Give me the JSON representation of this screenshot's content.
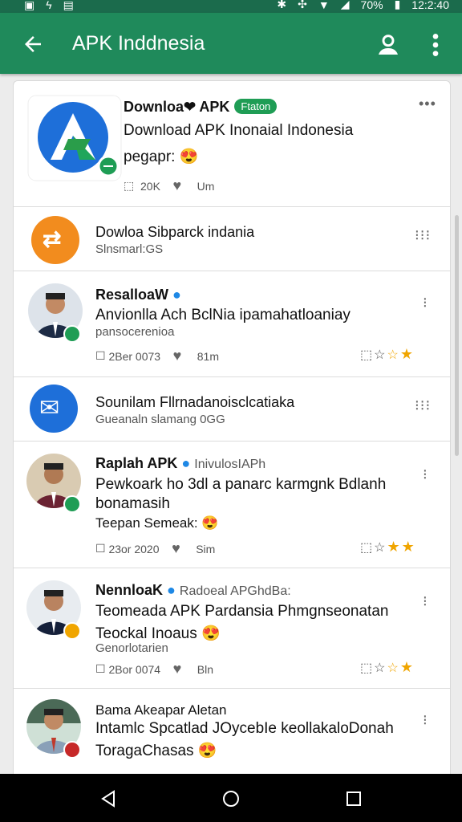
{
  "status": {
    "battery_pct": "70%",
    "time": "12:2:40"
  },
  "appbar": {
    "title": "APK Inddnesia"
  },
  "feed": [
    {
      "name": "Downloa❤ APK",
      "badge": "Ftaton",
      "text": "Download APK Inonaial Indonesia",
      "text2": "pegapr:",
      "likes": "20K",
      "meta3": "Um"
    },
    {
      "name": "Dowloa Sibparck indania",
      "sub": "Slnsmarl:GS"
    },
    {
      "name": "ResalloaW",
      "text": "Anvionlla Ach BclNia ipamahatloaniay",
      "sub": "pansocerenioa",
      "date": "2Ber 0073",
      "meta3": "81m"
    },
    {
      "name": "Sounilam Fllrnadanoisclcatiaka",
      "sub": "Gueanaln slamang 0GG"
    },
    {
      "name": "Raplah APK",
      "handle": "InivulosIAPh",
      "text": "Pewkoark ho 3dl a panarc karmgnk Bdlanh",
      "text2": "bonamasih",
      "text3": "Teepan Semeak:",
      "date": "23or 2020",
      "meta3": "Sim"
    },
    {
      "name": "NennloaK",
      "handle": "Radoeal APGhdBa:",
      "text": "Teomeada APK Pardansia Phmgnseonatan",
      "text2": "Teockal Inoaus",
      "sub": "Genorlotarien",
      "date": "2Bor 0074",
      "meta3": "Bln"
    },
    {
      "name": "Bama Akeapar Aletan",
      "text": "Intamlc Spcatlad JOycebIe keollakaloDonah",
      "text2": "ToragaChasas"
    }
  ],
  "colors": {
    "appbar": "#1f8a5b",
    "statusbar": "#1b6b4c",
    "accent": "#1f9d55",
    "star": "#f0a500",
    "verified": "#1e88e5"
  },
  "icons": [
    "back-arrow-icon",
    "account-icon",
    "more-vert-icon",
    "like-icon",
    "heart-icon",
    "star-icon",
    "verified-icon",
    "mail-icon",
    "nav-back-icon",
    "nav-home-icon",
    "nav-recents-icon"
  ]
}
